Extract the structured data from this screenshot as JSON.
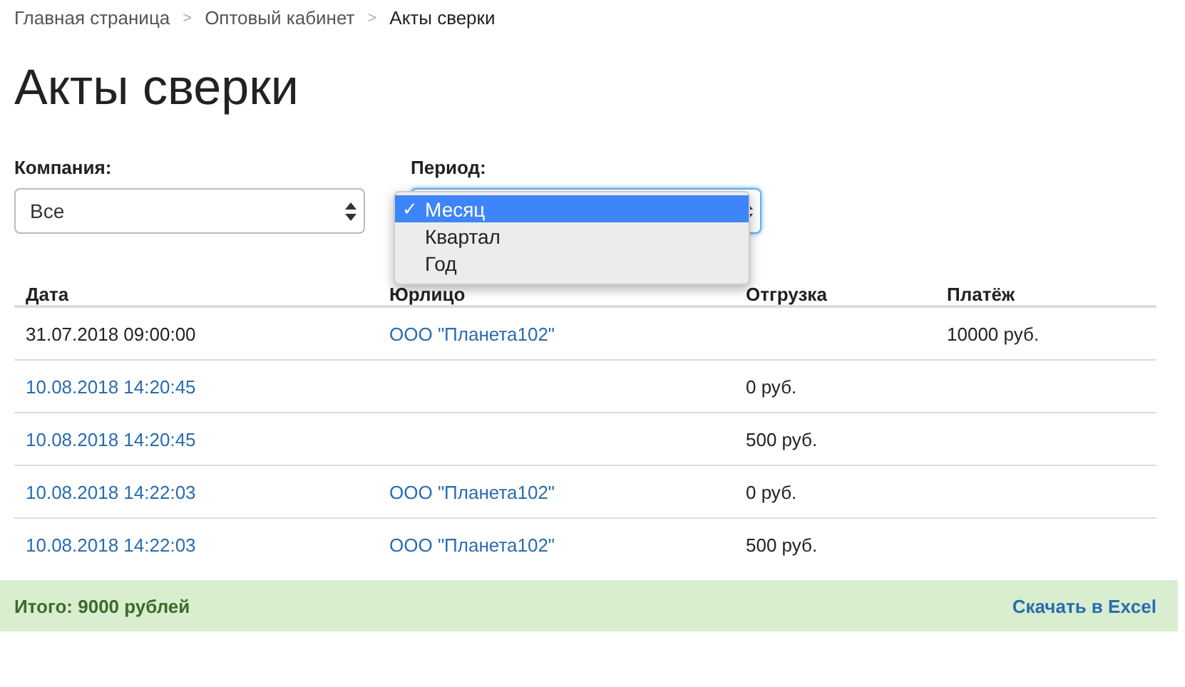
{
  "breadcrumbs": [
    {
      "label": "Главная страница",
      "current": false
    },
    {
      "label": "Оптовый кабинет",
      "current": false
    },
    {
      "label": "Акты сверки",
      "current": true
    }
  ],
  "breadcrumb_separator": ">",
  "title": "Акты сверки",
  "filters": [
    {
      "label": "Компания:",
      "value": "Все",
      "focused": false
    },
    {
      "label": "Период:",
      "focused": true,
      "open": true,
      "options": [
        {
          "label": "Месяц",
          "selected": true
        },
        {
          "label": "Квартал",
          "selected": false
        },
        {
          "label": "Год",
          "selected": false
        }
      ]
    }
  ],
  "check_mark": "✓",
  "table": {
    "columns": [
      "Дата",
      "Юрлицо",
      "Отгрузка",
      "Платёж"
    ],
    "rows": [
      [
        {
          "text": "31.07.2018 09:00:00",
          "link": false
        },
        {
          "text": "ООО \"Планета102\"",
          "link": true
        },
        null,
        {
          "text": "10000 руб.",
          "link": false
        }
      ],
      [
        {
          "text": "10.08.2018 14:20:45",
          "link": true
        },
        null,
        {
          "text": "0 руб.",
          "link": false
        },
        null
      ],
      [
        {
          "text": "10.08.2018 14:20:45",
          "link": true
        },
        null,
        {
          "text": "500 руб.",
          "link": false
        },
        null
      ],
      [
        {
          "text": "10.08.2018 14:22:03",
          "link": true
        },
        {
          "text": "ООО \"Планета102\"",
          "link": true
        },
        {
          "text": "0 руб.",
          "link": false
        },
        null
      ],
      [
        {
          "text": "10.08.2018 14:22:03",
          "link": true
        },
        {
          "text": "ООО \"Планета102\"",
          "link": true
        },
        {
          "text": "500 руб.",
          "link": false
        },
        null
      ]
    ]
  },
  "footer": {
    "total": "Итого: 9000 рублей",
    "download_link": "Скачать в Excel"
  }
}
